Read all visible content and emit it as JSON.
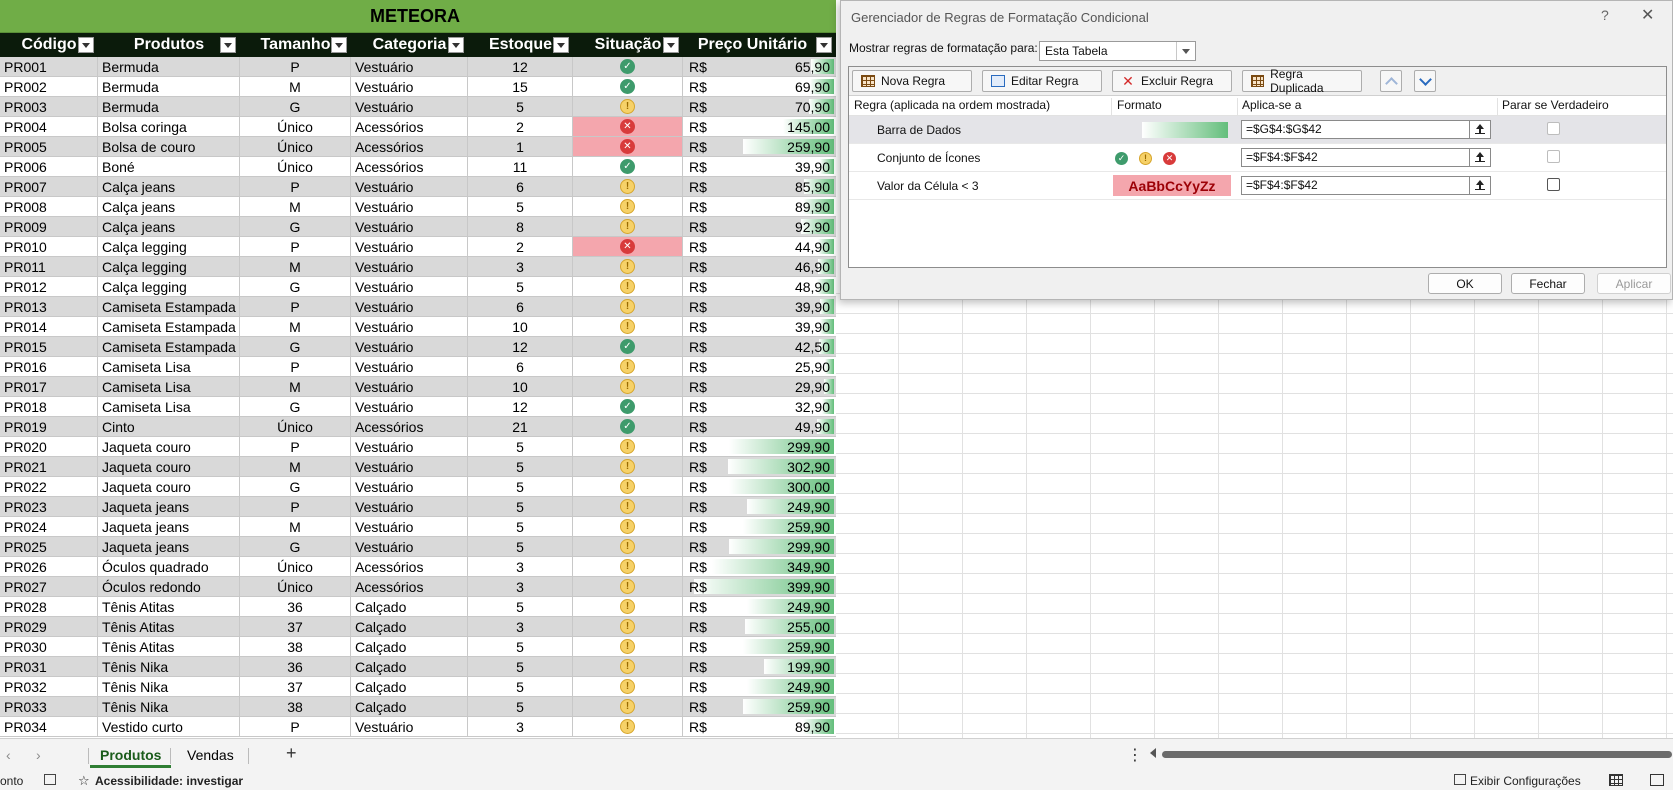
{
  "sheet": {
    "title": "METEORA",
    "headers": [
      "Código",
      "Produtos",
      "Tamanho",
      "Categoria",
      "Estoque",
      "Situação",
      "Preço Unitário"
    ],
    "currency": "R$",
    "rows": [
      {
        "code": "PR001",
        "product": "Bermuda",
        "size": "P",
        "category": "Vestuário",
        "stock": "12",
        "status": "ok",
        "price": "65,90"
      },
      {
        "code": "PR002",
        "product": "Bermuda",
        "size": "M",
        "category": "Vestuário",
        "stock": "15",
        "status": "ok",
        "price": "69,90"
      },
      {
        "code": "PR003",
        "product": "Bermuda",
        "size": "G",
        "category": "Vestuário",
        "stock": "5",
        "status": "warn",
        "price": "70,90"
      },
      {
        "code": "PR004",
        "product": "Bolsa coringa",
        "size": "Único",
        "category": "Acessórios",
        "stock": "2",
        "status": "bad",
        "price": "145,00"
      },
      {
        "code": "PR005",
        "product": "Bolsa de couro",
        "size": "Único",
        "category": "Acessórios",
        "stock": "1",
        "status": "bad",
        "price": "259,90"
      },
      {
        "code": "PR006",
        "product": "Boné",
        "size": "Único",
        "category": "Acessórios",
        "stock": "11",
        "status": "ok",
        "price": "39,90"
      },
      {
        "code": "PR007",
        "product": "Calça jeans",
        "size": "P",
        "category": "Vestuário",
        "stock": "6",
        "status": "warn",
        "price": "85,90"
      },
      {
        "code": "PR008",
        "product": "Calça jeans",
        "size": "M",
        "category": "Vestuário",
        "stock": "5",
        "status": "warn",
        "price": "89,90"
      },
      {
        "code": "PR009",
        "product": "Calça jeans",
        "size": "G",
        "category": "Vestuário",
        "stock": "8",
        "status": "warn",
        "price": "92,90"
      },
      {
        "code": "PR010",
        "product": "Calça legging",
        "size": "P",
        "category": "Vestuário",
        "stock": "2",
        "status": "bad",
        "price": "44,90"
      },
      {
        "code": "PR011",
        "product": "Calça legging",
        "size": "M",
        "category": "Vestuário",
        "stock": "3",
        "status": "warn",
        "price": "46,90"
      },
      {
        "code": "PR012",
        "product": "Calça legging",
        "size": "G",
        "category": "Vestuário",
        "stock": "5",
        "status": "warn",
        "price": "48,90"
      },
      {
        "code": "PR013",
        "product": "Camiseta Estampada",
        "size": "P",
        "category": "Vestuário",
        "stock": "6",
        "status": "warn",
        "price": "39,90"
      },
      {
        "code": "PR014",
        "product": "Camiseta Estampada",
        "size": "M",
        "category": "Vestuário",
        "stock": "10",
        "status": "warn",
        "price": "39,90"
      },
      {
        "code": "PR015",
        "product": "Camiseta Estampada",
        "size": "G",
        "category": "Vestuário",
        "stock": "12",
        "status": "ok",
        "price": "42,50"
      },
      {
        "code": "PR016",
        "product": "Camiseta Lisa",
        "size": "P",
        "category": "Vestuário",
        "stock": "6",
        "status": "warn",
        "price": "25,90"
      },
      {
        "code": "PR017",
        "product": "Camiseta Lisa",
        "size": "M",
        "category": "Vestuário",
        "stock": "10",
        "status": "warn",
        "price": "29,90"
      },
      {
        "code": "PR018",
        "product": "Camiseta Lisa",
        "size": "G",
        "category": "Vestuário",
        "stock": "12",
        "status": "ok",
        "price": "32,90"
      },
      {
        "code": "PR019",
        "product": "Cinto",
        "size": "Único",
        "category": "Acessórios",
        "stock": "21",
        "status": "ok",
        "price": "49,90"
      },
      {
        "code": "PR020",
        "product": "Jaqueta couro",
        "size": "P",
        "category": "Vestuário",
        "stock": "5",
        "status": "warn",
        "price": "299,90"
      },
      {
        "code": "PR021",
        "product": "Jaqueta couro",
        "size": "M",
        "category": "Vestuário",
        "stock": "5",
        "status": "warn",
        "price": "302,90"
      },
      {
        "code": "PR022",
        "product": "Jaqueta couro",
        "size": "G",
        "category": "Vestuário",
        "stock": "5",
        "status": "warn",
        "price": "300,00"
      },
      {
        "code": "PR023",
        "product": "Jaqueta jeans",
        "size": "P",
        "category": "Vestuário",
        "stock": "5",
        "status": "warn",
        "price": "249,90"
      },
      {
        "code": "PR024",
        "product": "Jaqueta jeans",
        "size": "M",
        "category": "Vestuário",
        "stock": "5",
        "status": "warn",
        "price": "259,90"
      },
      {
        "code": "PR025",
        "product": "Jaqueta jeans",
        "size": "G",
        "category": "Vestuário",
        "stock": "5",
        "status": "warn",
        "price": "299,90"
      },
      {
        "code": "PR026",
        "product": "Óculos quadrado",
        "size": "Único",
        "category": "Acessórios",
        "stock": "3",
        "status": "warn",
        "price": "349,90"
      },
      {
        "code": "PR027",
        "product": "Óculos redondo",
        "size": "Único",
        "category": "Acessórios",
        "stock": "3",
        "status": "warn",
        "price": "399,90"
      },
      {
        "code": "PR028",
        "product": "Tênis Atitas",
        "size": "36",
        "category": "Calçado",
        "stock": "5",
        "status": "warn",
        "price": "249,90"
      },
      {
        "code": "PR029",
        "product": "Tênis Atitas",
        "size": "37",
        "category": "Calçado",
        "stock": "3",
        "status": "warn",
        "price": "255,00"
      },
      {
        "code": "PR030",
        "product": "Tênis Atitas",
        "size": "38",
        "category": "Calçado",
        "stock": "5",
        "status": "warn",
        "price": "259,90"
      },
      {
        "code": "PR031",
        "product": "Tênis Nika",
        "size": "36",
        "category": "Calçado",
        "stock": "5",
        "status": "warn",
        "price": "199,90"
      },
      {
        "code": "PR032",
        "product": "Tênis Nika",
        "size": "37",
        "category": "Calçado",
        "stock": "5",
        "status": "warn",
        "price": "249,90"
      },
      {
        "code": "PR033",
        "product": "Tênis Nika",
        "size": "38",
        "category": "Calçado",
        "stock": "5",
        "status": "warn",
        "price": "259,90"
      },
      {
        "code": "PR034",
        "product": "Vestido curto",
        "size": "P",
        "category": "Vestuário",
        "stock": "3",
        "status": "warn",
        "price": "89,90"
      }
    ]
  },
  "tabs": {
    "items": [
      "Produtos",
      "Vendas"
    ],
    "active": "Produtos"
  },
  "status_bar": {
    "mode": "onto",
    "accessibility": "Acessibilidade: investigar",
    "settings": "Exibir Configurações"
  },
  "dialog": {
    "title": "Gerenciador de Regras de Formatação Condicional",
    "help": "?",
    "close": "✕",
    "show_rules_label": "Mostrar regras de formatação para:",
    "show_rules_value": "Esta Tabela",
    "buttons": {
      "new": "Nova Regra",
      "edit": "Editar Regra",
      "delete": "Excluir Regra",
      "duplicate": "Regra Duplicada"
    },
    "columns": {
      "rule": "Regra (aplicada na ordem mostrada)",
      "format": "Formato",
      "applies": "Aplica-se a",
      "stop": "Parar se Verdadeiro"
    },
    "rules": [
      {
        "name": "Barra de Dados",
        "applies": "=$G$4:$G$42"
      },
      {
        "name": "Conjunto de Ícones",
        "applies": "=$F$4:$F$42"
      },
      {
        "name": "Valor da Célula < 3",
        "applies": "=$F$4:$F$42",
        "format_sample": "AaBbCcYyZz"
      }
    ],
    "footer": {
      "ok": "OK",
      "close": "Fechar",
      "apply": "Aplicar"
    }
  },
  "colors": {
    "title_bg": "#70ad47",
    "header_bg": "#0b1b0b",
    "low_stock_fill": "#f4a6ad",
    "databar": "#63be7b"
  }
}
